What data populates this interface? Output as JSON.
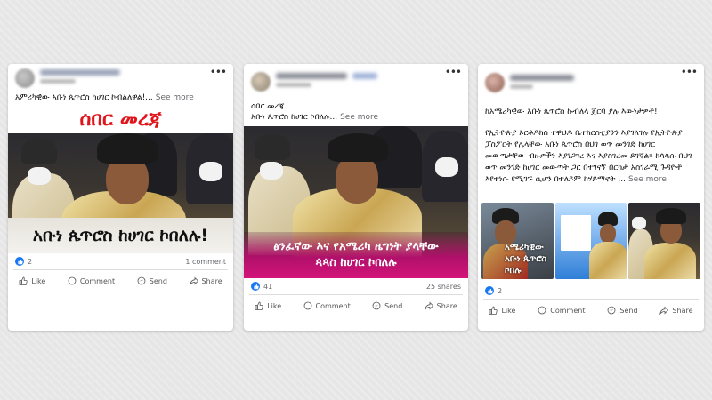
{
  "posts": [
    {
      "text": "አምሪካዊው አቡነ ጴጥሮስ ከሀገር ኮብልለዋል!...",
      "see_more": "See more",
      "image_top_text": "ሰበር መረጃ",
      "image_caption": "አቡነ ጴጥሮስ ከሀገር ኮበለሉ!",
      "likes": "2",
      "secondary_stat": "1 comment",
      "actions": [
        "Like",
        "Comment",
        "Send",
        "Share"
      ]
    },
    {
      "text_line1": "ሰበር መረጃ",
      "text_line2": "አቡነ ጴጥሮስ ከሀገር ኮበለሉ...",
      "see_more": "See more",
      "image_caption_line1": "ፅንፈኛው እና የአሜሪካ ዜግነት ያላቸው",
      "image_caption_line2": "ጳጳስ ከሀገር ኮበለሉ",
      "likes": "41",
      "secondary_stat": "25 shares",
      "actions": [
        "Like",
        "Comment",
        "Send",
        "Share"
      ]
    },
    {
      "text_line1": "ከአሜሪካዊው አቡነ ጴጥሮስ ኩብለላ ጀርባ ያሉ እውነታዎች!",
      "text_para": "የኢትዮጵያ ኦርቶዶክስ ተዋህዶ ቤተክርስቲያንን እያገለገሉ የኢትዮጵያ ፓስፖርት የሌላቸው አቡነ ጴጥሮስ በህገ ወጥ መንገድ ከሀገር መውጣታቸው ብዙዎችን እያነጋገረ እና እያስገረመ ይገኛል። ከጳጳሱ በህገ ወጥ መንገድ ከሀገር መውጣት ጋር በተገናኘ በርካታ አስገራሚ ጉዳዮች እየተነሱ የሚገኙ ሲሆን በተለይም ከሃይማኖት ...",
      "see_more": "See more",
      "thumb1_caption": "አሜሪካዊው አቡነ ጴጥሮስ ኮበሉ",
      "likes": "2",
      "actions": [
        "Like",
        "Comment",
        "Send",
        "Share"
      ]
    }
  ]
}
